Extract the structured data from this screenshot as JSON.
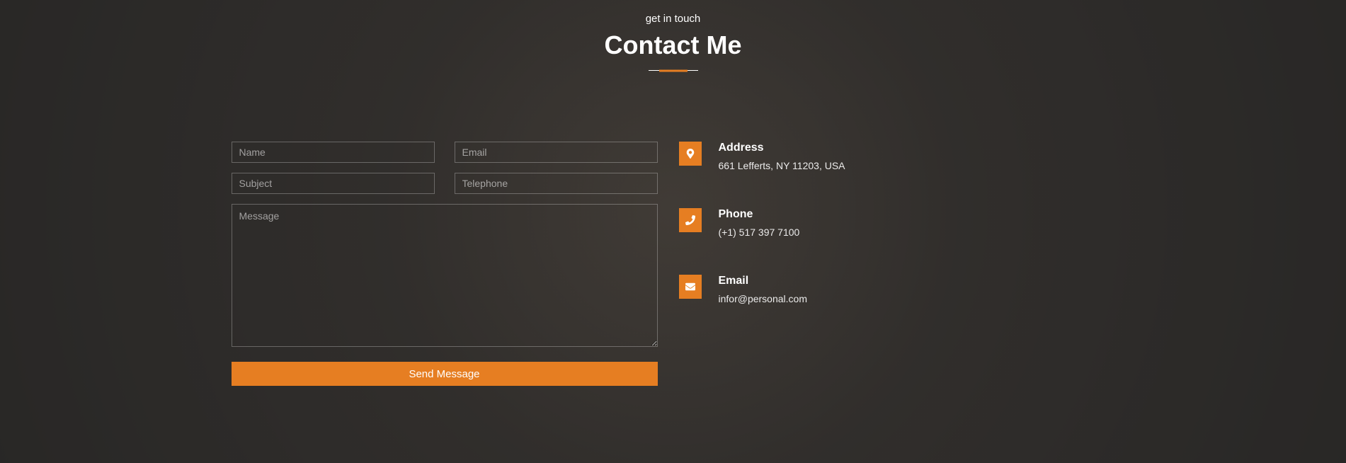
{
  "header": {
    "subtitle": "get in touch",
    "title": "Contact Me"
  },
  "form": {
    "name_placeholder": "Name",
    "email_placeholder": "Email",
    "subject_placeholder": "Subject",
    "telephone_placeholder": "Telephone",
    "message_placeholder": "Message",
    "submit_label": "Send Message"
  },
  "info": {
    "address": {
      "label": "Address",
      "value": "661 Lefferts, NY 11203, USA"
    },
    "phone": {
      "label": "Phone",
      "value": "(+1) 517 397 7100"
    },
    "email": {
      "label": "Email",
      "value": "infor@personal.com"
    }
  }
}
